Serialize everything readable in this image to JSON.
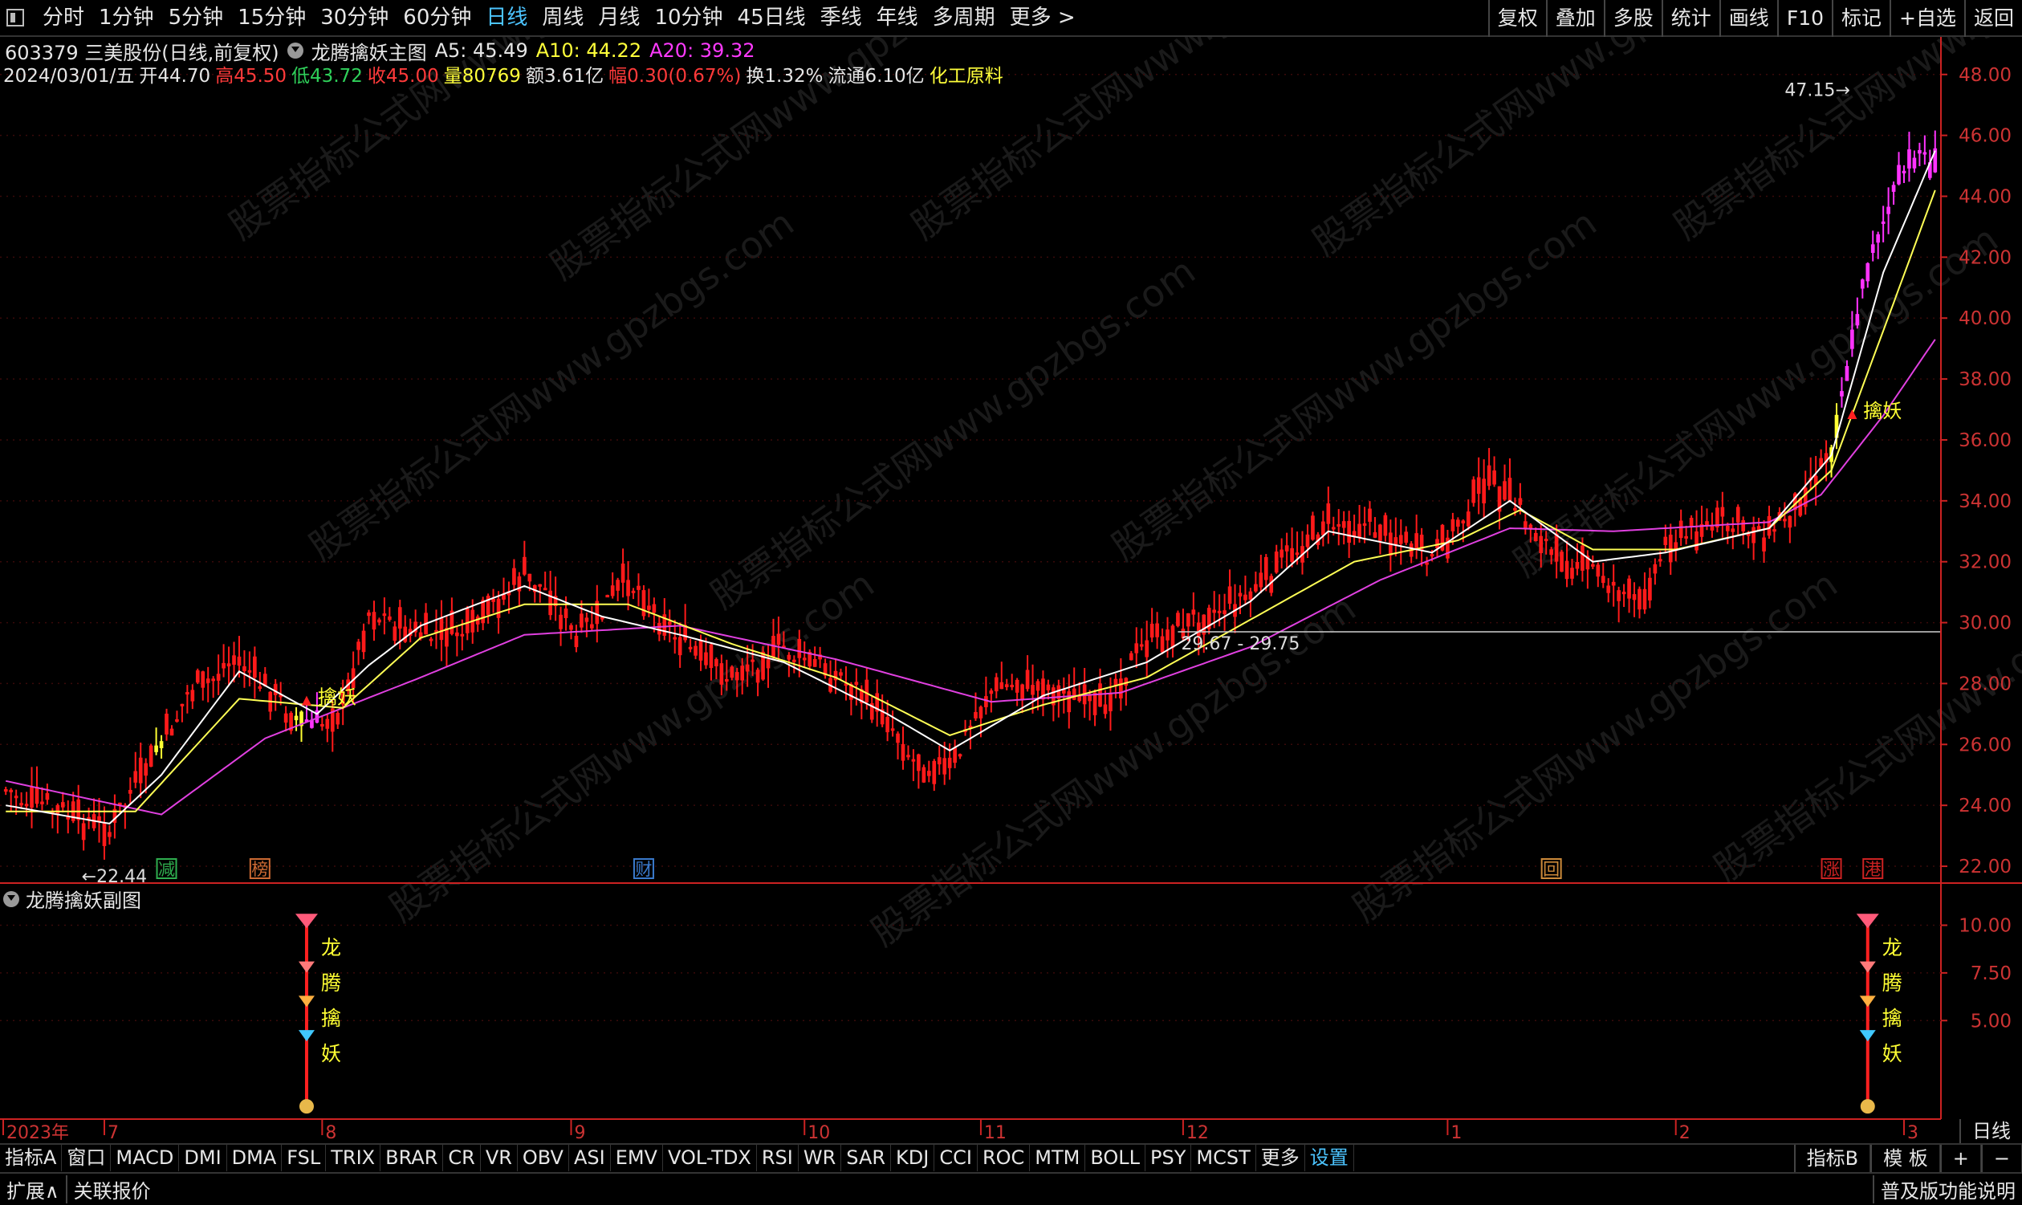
{
  "toolbar": {
    "periods": [
      "分时",
      "1分钟",
      "5分钟",
      "15分钟",
      "30分钟",
      "60分钟",
      "日线",
      "周线",
      "月线",
      "10分钟",
      "45日线",
      "季线",
      "年线",
      "多周期",
      "更多 >"
    ],
    "active_period": "日线",
    "right_tools": [
      "复权",
      "叠加",
      "多股",
      "统计",
      "画线",
      "F10",
      "标记",
      "+自选",
      "返回"
    ]
  },
  "stock": {
    "code_name": "603379 三美股份(日线,前复权)",
    "main_indicator": "龙腾擒妖主图",
    "a5": "A5: 45.49",
    "a10": "A10: 44.22",
    "a20": "A20: 39.32",
    "date": "2024/03/01/五",
    "open": "开44.70",
    "high": "高45.50",
    "low": "低43.72",
    "close": "收45.00",
    "volume": "量80769",
    "amount": "额3.61亿",
    "change": "幅0.30(0.67%)",
    "turnover": "换1.32%",
    "float": "流通6.10亿",
    "sector": "化工原料"
  },
  "colors": {
    "up": "#ff1a1a",
    "signal": "#ffff33",
    "surge": "#ff33ff",
    "ma5": "#ffffff",
    "ma10": "#ffff55",
    "ma20": "#e040e0",
    "axis": "#cc2222"
  },
  "chart_data": {
    "type": "candlestick",
    "ylim": [
      21.5,
      48.6
    ],
    "y_ticks": [
      "48.00",
      "46.00",
      "44.00",
      "42.00",
      "40.00",
      "38.00",
      "36.00",
      "34.00",
      "32.00",
      "30.00",
      "28.00",
      "26.00",
      "24.00",
      "22.00"
    ],
    "sub_ylim": [
      0,
      12
    ],
    "sub_ticks": [
      "10.00",
      "7.50",
      "5.00"
    ],
    "x_ticks": [
      "2023年",
      "7",
      "8",
      "9",
      "10",
      "11",
      "12",
      "1",
      "2",
      "3"
    ],
    "annotations": {
      "low": "22.44",
      "high": "47.15",
      "line_label": "29.67 - 29.75",
      "signal_label": "擒妖",
      "watermark": "股票指标公式网www.gpzbgs.com"
    },
    "event_markers": [
      "减",
      "榜",
      "财",
      "回",
      "涨",
      "港"
    ],
    "sub_chain": [
      "龙",
      "腾",
      "擒",
      "妖"
    ],
    "price_path": [
      [
        0,
        24.5
      ],
      [
        10,
        23.8
      ],
      [
        20,
        23.2
      ],
      [
        25,
        24.6
      ],
      [
        35,
        27.6
      ],
      [
        45,
        28.8
      ],
      [
        55,
        27.0
      ],
      [
        60,
        26.6
      ],
      [
        65,
        27.2
      ],
      [
        70,
        30.3
      ],
      [
        80,
        29.6
      ],
      [
        90,
        29.8
      ],
      [
        100,
        31.6
      ],
      [
        105,
        30.9
      ],
      [
        110,
        29.4
      ],
      [
        115,
        30.4
      ],
      [
        120,
        31.5
      ],
      [
        130,
        29.4
      ],
      [
        140,
        28.2
      ],
      [
        150,
        29.2
      ],
      [
        160,
        28.3
      ],
      [
        170,
        26.9
      ],
      [
        175,
        25.5
      ],
      [
        182,
        25.2
      ],
      [
        190,
        27.8
      ],
      [
        200,
        28.0
      ],
      [
        210,
        27.1
      ],
      [
        220,
        29.3
      ],
      [
        230,
        30.2
      ],
      [
        240,
        31.0
      ],
      [
        250,
        32.6
      ],
      [
        255,
        33.4
      ],
      [
        265,
        33.1
      ],
      [
        275,
        32.0
      ],
      [
        285,
        34.6
      ],
      [
        290,
        34.1
      ],
      [
        298,
        32.3
      ],
      [
        306,
        31.8
      ],
      [
        315,
        30.6
      ],
      [
        320,
        32.6
      ],
      [
        330,
        33.3
      ],
      [
        340,
        33.0
      ],
      [
        345,
        33.9
      ],
      [
        352,
        35.8
      ],
      [
        360,
        42.5
      ],
      [
        368,
        45.5
      ],
      [
        372,
        45.0
      ]
    ],
    "ma5_path": [
      [
        0,
        24.0
      ],
      [
        20,
        23.4
      ],
      [
        30,
        25.0
      ],
      [
        45,
        28.4
      ],
      [
        60,
        27.0
      ],
      [
        70,
        28.6
      ],
      [
        80,
        29.9
      ],
      [
        100,
        31.2
      ],
      [
        115,
        30.2
      ],
      [
        130,
        29.6
      ],
      [
        150,
        28.7
      ],
      [
        170,
        27.0
      ],
      [
        182,
        25.8
      ],
      [
        200,
        27.6
      ],
      [
        220,
        28.7
      ],
      [
        240,
        30.7
      ],
      [
        255,
        33.0
      ],
      [
        275,
        32.3
      ],
      [
        290,
        34.0
      ],
      [
        306,
        32.0
      ],
      [
        320,
        32.3
      ],
      [
        340,
        33.1
      ],
      [
        352,
        35.5
      ],
      [
        362,
        41.5
      ],
      [
        372,
        45.5
      ]
    ],
    "ma10_path": [
      [
        0,
        23.8
      ],
      [
        25,
        23.8
      ],
      [
        45,
        27.5
      ],
      [
        65,
        27.2
      ],
      [
        80,
        29.5
      ],
      [
        100,
        30.6
      ],
      [
        120,
        30.6
      ],
      [
        140,
        29.3
      ],
      [
        160,
        28.2
      ],
      [
        182,
        26.3
      ],
      [
        200,
        27.3
      ],
      [
        220,
        28.2
      ],
      [
        240,
        30.1
      ],
      [
        260,
        32.0
      ],
      [
        280,
        32.7
      ],
      [
        292,
        33.7
      ],
      [
        306,
        32.4
      ],
      [
        322,
        32.4
      ],
      [
        340,
        33.1
      ],
      [
        352,
        35.0
      ],
      [
        364,
        40.5
      ],
      [
        372,
        44.2
      ]
    ],
    "ma20_path": [
      [
        0,
        24.8
      ],
      [
        30,
        23.7
      ],
      [
        50,
        26.2
      ],
      [
        80,
        28.2
      ],
      [
        100,
        29.6
      ],
      [
        130,
        29.9
      ],
      [
        160,
        28.8
      ],
      [
        190,
        27.4
      ],
      [
        215,
        27.7
      ],
      [
        240,
        29.2
      ],
      [
        265,
        31.4
      ],
      [
        290,
        33.1
      ],
      [
        310,
        33.0
      ],
      [
        340,
        33.3
      ],
      [
        350,
        34.2
      ],
      [
        362,
        36.8
      ],
      [
        372,
        39.3
      ]
    ]
  },
  "sub_panel": {
    "title": "龙腾擒妖副图"
  },
  "indicator_tabs": [
    "指标A",
    "窗口",
    "MACD",
    "DMI",
    "DMA",
    "FSL",
    "TRIX",
    "BRAR",
    "CR",
    "VR",
    "OBV",
    "ASI",
    "EMV",
    "VOL-TDX",
    "RSI",
    "WR",
    "SAR",
    "KDJ",
    "CCI",
    "ROC",
    "MTM",
    "BOLL",
    "PSY",
    "MCST",
    "更多",
    "设置"
  ],
  "active_tab": "设置",
  "tab_right": [
    "指标B",
    "模 板",
    "+",
    "−"
  ],
  "bottom": {
    "expand": "扩展∧",
    "related": "关联报价",
    "version_note": "普及版功能说明",
    "day_line": "日线"
  }
}
